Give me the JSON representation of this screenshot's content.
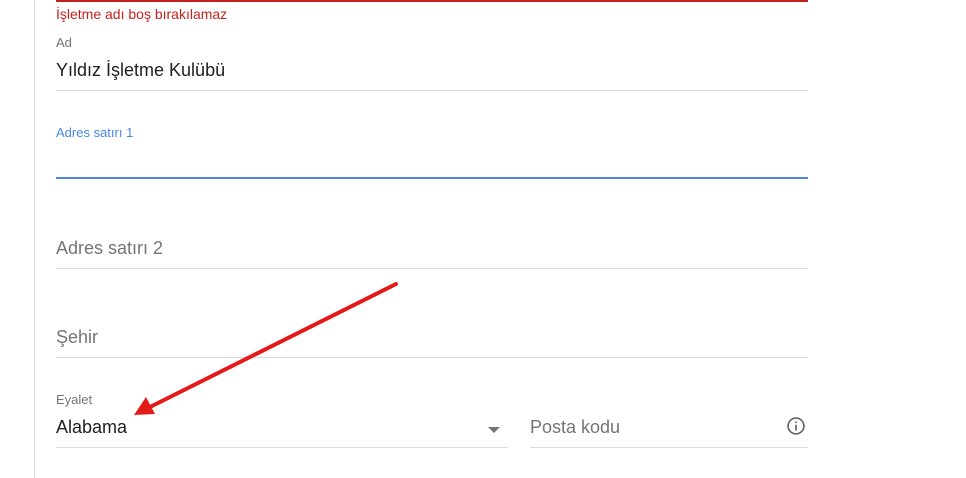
{
  "form": {
    "business_name_error": "İşletme adı boş bırakılamaz",
    "name": {
      "label": "Ad",
      "value": "Yıldız İşletme Kulübü"
    },
    "address_line_1": {
      "label": "Adres satırı 1",
      "value": ""
    },
    "address_line_2": {
      "placeholder": "Adres satırı 2"
    },
    "city": {
      "placeholder": "Şehir"
    },
    "state": {
      "label": "Eyalet",
      "value": "Alabama"
    },
    "postal_code": {
      "placeholder": "Posta kodu"
    }
  },
  "icons": {
    "dropdown": "chevron-down-icon",
    "info": "info-icon"
  },
  "colors": {
    "error": "#c5221f",
    "focus": "#4a86e8",
    "annotation_arrow": "#e31b1b"
  }
}
